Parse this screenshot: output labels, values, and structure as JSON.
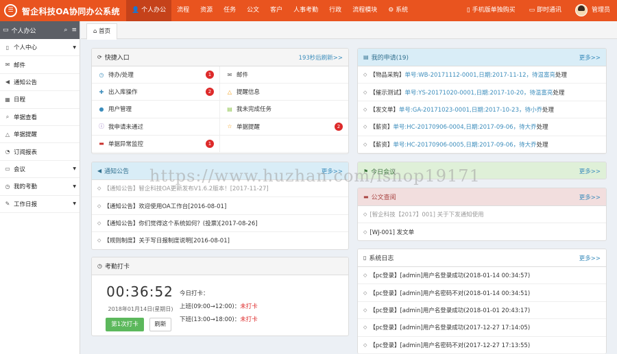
{
  "app": {
    "logo_glyph": "☰",
    "title": "智企科技OA协同办公系统",
    "accent": "#e9541f"
  },
  "topnav": [
    {
      "label": "👤 个人办公",
      "active": true
    },
    {
      "label": "流程"
    },
    {
      "label": "资源"
    },
    {
      "label": "任务"
    },
    {
      "label": "公文"
    },
    {
      "label": "客户"
    },
    {
      "label": "人事考勤"
    },
    {
      "label": "行政"
    },
    {
      "label": "流程模块"
    },
    {
      "label": "⚙ 系统"
    }
  ],
  "topright": {
    "mobile": "手机版单独购买",
    "chat": "即时通讯",
    "user": "管理员"
  },
  "sidebar": {
    "header": "个人办公",
    "items": [
      {
        "icon": "bookmark-icon",
        "glyph": "▯",
        "label": "个人中心",
        "caret": true
      },
      {
        "icon": "mail-icon",
        "glyph": "✉",
        "label": "邮件",
        "caret": false
      },
      {
        "icon": "megaphone-icon",
        "glyph": "◀",
        "label": "通知公告",
        "caret": false
      },
      {
        "icon": "calendar-icon",
        "glyph": "▦",
        "label": "日程",
        "caret": false
      },
      {
        "icon": "search-icon",
        "glyph": "⌕",
        "label": "单据查看",
        "caret": false
      },
      {
        "icon": "bell-icon",
        "glyph": "△",
        "label": "单据提醒",
        "caret": false
      },
      {
        "icon": "rss-icon",
        "glyph": "◔",
        "label": "订阅报表",
        "caret": false
      },
      {
        "icon": "chat-icon",
        "glyph": "▭",
        "label": "会议",
        "caret": true
      },
      {
        "icon": "clock-icon",
        "glyph": "◷",
        "label": "我的考勤",
        "caret": true
      },
      {
        "icon": "edit-icon",
        "glyph": "✎",
        "label": "工作日报",
        "caret": true
      }
    ]
  },
  "tabs": {
    "home": "首页"
  },
  "quick": {
    "title": "快捷入口",
    "more": "193秒后刷新>>",
    "items": [
      {
        "icon": "clock-icon",
        "glyph": "◷",
        "color": "#3c8dbc",
        "label": "待办/处理",
        "badge": "1"
      },
      {
        "icon": "mail-icon",
        "glyph": "✉",
        "color": "#555",
        "label": "邮件",
        "badge": ""
      },
      {
        "icon": "plus-icon",
        "glyph": "✚",
        "color": "#3c8dbc",
        "label": "出入库操作",
        "badge": "2"
      },
      {
        "icon": "bell-icon",
        "glyph": "△",
        "color": "#f39c12",
        "label": "提醒信息",
        "badge": ""
      },
      {
        "icon": "user-icon",
        "glyph": "●",
        "color": "#3c8dbc",
        "label": "用户管理",
        "badge": ""
      },
      {
        "icon": "book-icon",
        "glyph": "▤",
        "color": "#8bc34a",
        "label": "我未完成任务",
        "badge": ""
      },
      {
        "icon": "info-icon",
        "glyph": "ⓘ",
        "color": "#8e6bbf",
        "label": "我申请未通过",
        "badge": ""
      },
      {
        "icon": "star-icon",
        "glyph": "☆",
        "color": "#f39c12",
        "label": "单据提醒",
        "badge": "2"
      },
      {
        "icon": "briefcase-icon",
        "glyph": "▬",
        "color": "#c9302c",
        "label": "单据异常监控",
        "badge": "1"
      },
      {
        "icon": "",
        "glyph": "",
        "color": "#555",
        "label": "",
        "badge": ""
      }
    ]
  },
  "myapply": {
    "title": "我的申请(19)",
    "more": "更多>>",
    "rows": [
      {
        "tag": "【物品采购】",
        "no": "单号:WB-20171112-0001,日期:2017-11-12，待",
        "who": "温富亮",
        "tail": "处理"
      },
      {
        "tag": "【催示测试】",
        "no": "单号:YS-20171020-0001,日期:2017-10-20，待",
        "who": "温富亮",
        "tail": "处理"
      },
      {
        "tag": "【发文单】",
        "no": "单号:GA-20171023-0001,日期:2017-10-23，待",
        "who": "小乔",
        "tail": "处理"
      },
      {
        "tag": "【薪资】",
        "no": "单号:HC-20170906-0004,日期:2017-09-06，待",
        "who": "大乔",
        "tail": "处理"
      },
      {
        "tag": "【薪资】",
        "no": "单号:HC-20170906-0005,日期:2017-09-06，待",
        "who": "大乔",
        "tail": "处理"
      }
    ]
  },
  "notice": {
    "title": "通知公告",
    "more": "更多>>",
    "rows": [
      {
        "text": "【通知公告】智企科技OA更新发布V1.6.2版本！[2017-11-27]",
        "faded": true
      },
      {
        "text": "【通知公告】欢迎使用OA工作台[2016-08-01]",
        "faded": false
      },
      {
        "text": "【通知公告】你们觉得这个系统如何？(投票)[2017-08-26]",
        "faded": false
      },
      {
        "text": "【规则制度】关于写日报制度说明[2016-08-01]",
        "faded": false
      }
    ]
  },
  "meeting": {
    "title": "今日会议",
    "more": "更多>>"
  },
  "docs": {
    "title": "公文查阅",
    "more": "更多>>",
    "rows": [
      {
        "text": "[智企科技【2017】001] 关于下发通知使用",
        "faded": true
      },
      {
        "text": "[WJ-001] 发文单",
        "faded": false
      }
    ]
  },
  "attendance": {
    "title": "考勤打卡",
    "time": "00:36:52",
    "date": "2018年01月14日(星期日)",
    "punch_btn": "第1次打卡",
    "refresh_btn": "刷新",
    "today": "今日打卡：",
    "am": "上班(09:00→12:00)：",
    "am_status": "未打卡",
    "pm": "下班(13:00→18:00)：",
    "pm_status": "未打卡"
  },
  "syslog": {
    "title": "系统日志",
    "more": "更多>>",
    "rows": [
      {
        "text": "【pc登录】[admin]用户名登录成功(2018-01-14 00:34:57)"
      },
      {
        "text": "【pc登录】[admin]用户名密码不对(2018-01-14 00:34:51)"
      },
      {
        "text": "【pc登录】[admin]用户名登录成功(2018-01-01 20:43:17)"
      },
      {
        "text": "【pc登录】[admin]用户名登录成功(2017-12-27 17:14:05)"
      },
      {
        "text": "【pc登录】[admin]用户名密码不对(2017-12-27 17:13:55)"
      }
    ]
  },
  "watermark": "https://www.huzhan.com/ishop19171"
}
